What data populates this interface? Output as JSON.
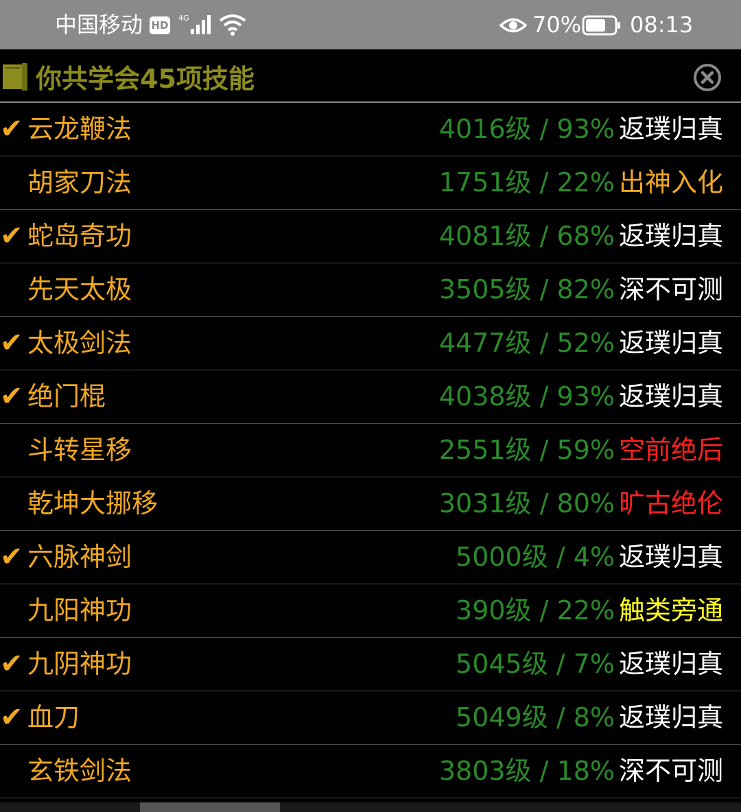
{
  "status_bar": {
    "carrier": "中国移动",
    "hd_badge": "HD",
    "network": "4G",
    "battery_pct": "70%",
    "battery_level": 0.7,
    "time": "08:13"
  },
  "header": {
    "title": "你共学会45项技能"
  },
  "colors": {
    "orange": "#f0a820",
    "green": "#2a8a2a",
    "white": "#ffffff",
    "red": "#ff2020",
    "yellow": "#ffff20",
    "title": "#8c8c1e"
  },
  "skills": [
    {
      "checked": true,
      "name": "云龙鞭法",
      "stat": "4016级 / 93%",
      "grade": "返璞归真",
      "grade_color": "#ffffff"
    },
    {
      "checked": false,
      "name": "胡家刀法",
      "stat": "1751级 / 22%",
      "grade": "出神入化",
      "grade_color": "#f0a820"
    },
    {
      "checked": true,
      "name": "蛇岛奇功",
      "stat": "4081级 / 68%",
      "grade": "返璞归真",
      "grade_color": "#ffffff"
    },
    {
      "checked": false,
      "name": "先天太极",
      "stat": "3505级 / 82%",
      "grade": "深不可测",
      "grade_color": "#ffffff"
    },
    {
      "checked": true,
      "name": "太极剑法",
      "stat": "4477级 / 52%",
      "grade": "返璞归真",
      "grade_color": "#ffffff"
    },
    {
      "checked": true,
      "name": "绝门棍",
      "stat": "4038级 / 93%",
      "grade": "返璞归真",
      "grade_color": "#ffffff"
    },
    {
      "checked": false,
      "name": "斗转星移",
      "stat": "2551级 / 59%",
      "grade": "空前绝后",
      "grade_color": "#ff2020"
    },
    {
      "checked": false,
      "name": "乾坤大挪移",
      "stat": "3031级 / 80%",
      "grade": "旷古绝伦",
      "grade_color": "#ff2020"
    },
    {
      "checked": true,
      "name": "六脉神剑",
      "stat": "5000级 / 4%",
      "grade": "返璞归真",
      "grade_color": "#ffffff"
    },
    {
      "checked": false,
      "name": "九阳神功",
      "stat": "390级 / 22%",
      "grade": "触类旁通",
      "grade_color": "#ffff20"
    },
    {
      "checked": true,
      "name": "九阴神功",
      "stat": "5045级 / 7%",
      "grade": "返璞归真",
      "grade_color": "#ffffff"
    },
    {
      "checked": true,
      "name": "血刀",
      "stat": "5049级 / 8%",
      "grade": "返璞归真",
      "grade_color": "#ffffff"
    },
    {
      "checked": false,
      "name": "玄铁剑法",
      "stat": "3803级 / 18%",
      "grade": "深不可测",
      "grade_color": "#ffffff"
    }
  ]
}
